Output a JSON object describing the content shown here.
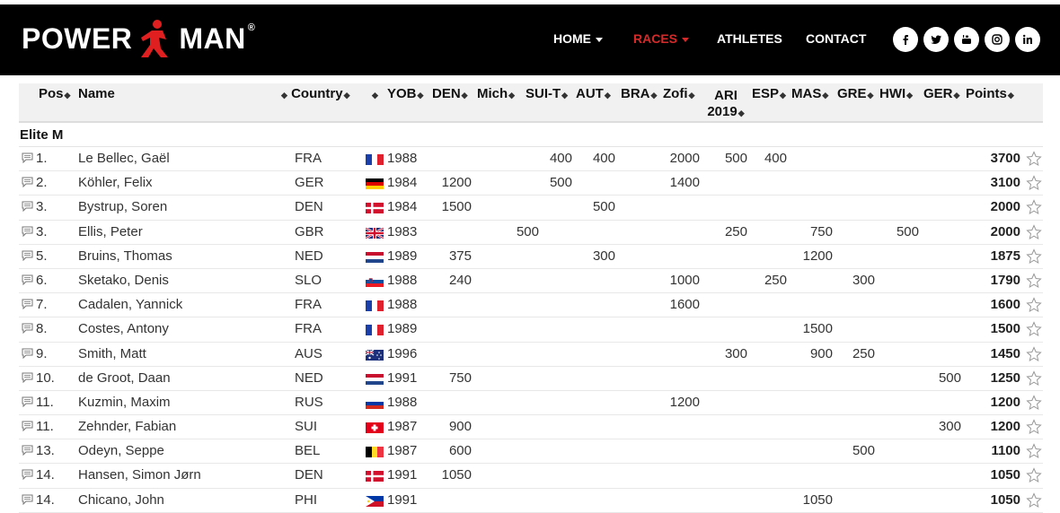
{
  "brand": {
    "name_left": "POWER",
    "name_right": "MAN",
    "registered": "®"
  },
  "nav": [
    {
      "label": "HOME",
      "caret": true,
      "active": false
    },
    {
      "label": "RACES",
      "caret": true,
      "active": true
    },
    {
      "label": "ATHLETES",
      "caret": false,
      "active": false
    },
    {
      "label": "CONTACT",
      "caret": false,
      "active": false
    }
  ],
  "social": [
    "facebook-icon",
    "twitter-icon",
    "youtube-icon",
    "instagram-icon",
    "linkedin-icon"
  ],
  "colors": {
    "accent": "#d62a2a",
    "header_bg": "#000000",
    "head_bg": "#f1f1f1"
  },
  "table": {
    "headers": [
      "Pos",
      "Name",
      "Country",
      "",
      "YOB",
      "DEN",
      "Mich",
      "SUI-T",
      "AUT",
      "BRA",
      "Zofi",
      "ARI 2019",
      "ESP",
      "MAS",
      "GRE",
      "HWI",
      "GER",
      "Points"
    ],
    "group": "Elite M",
    "rows": [
      {
        "pos": "1.",
        "name": "Le Bellec, Gaël",
        "country": "FRA",
        "flag": "fra",
        "yob": "1988",
        "den": "",
        "mich": "",
        "suit": "400",
        "aut": "400",
        "bra": "",
        "zofi": "2000",
        "ari": "500",
        "esp": "400",
        "mas": "",
        "gre": "",
        "hwi": "",
        "ger": "",
        "points": "3700"
      },
      {
        "pos": "2.",
        "name": "Köhler, Felix",
        "country": "GER",
        "flag": "ger",
        "yob": "1984",
        "den": "1200",
        "mich": "",
        "suit": "500",
        "aut": "",
        "bra": "",
        "zofi": "1400",
        "ari": "",
        "esp": "",
        "mas": "",
        "gre": "",
        "hwi": "",
        "ger": "",
        "points": "3100"
      },
      {
        "pos": "3.",
        "name": "Bystrup, Soren",
        "country": "DEN",
        "flag": "den",
        "yob": "1984",
        "den": "1500",
        "mich": "",
        "suit": "",
        "aut": "500",
        "bra": "",
        "zofi": "",
        "ari": "",
        "esp": "",
        "mas": "",
        "gre": "",
        "hwi": "",
        "ger": "",
        "points": "2000"
      },
      {
        "pos": "3.",
        "name": "Ellis, Peter",
        "country": "GBR",
        "flag": "gbr",
        "yob": "1983",
        "den": "",
        "mich": "500",
        "suit": "",
        "aut": "",
        "bra": "",
        "zofi": "",
        "ari": "250",
        "esp": "",
        "mas": "750",
        "gre": "",
        "hwi": "500",
        "ger": "",
        "points": "2000"
      },
      {
        "pos": "5.",
        "name": "Bruins, Thomas",
        "country": "NED",
        "flag": "ned",
        "yob": "1989",
        "den": "375",
        "mich": "",
        "suit": "",
        "aut": "300",
        "bra": "",
        "zofi": "",
        "ari": "",
        "esp": "",
        "mas": "1200",
        "gre": "",
        "hwi": "",
        "ger": "",
        "points": "1875"
      },
      {
        "pos": "6.",
        "name": "Sketako, Denis",
        "country": "SLO",
        "flag": "slo",
        "yob": "1988",
        "den": "240",
        "mich": "",
        "suit": "",
        "aut": "",
        "bra": "",
        "zofi": "1000",
        "ari": "",
        "esp": "250",
        "mas": "",
        "gre": "300",
        "hwi": "",
        "ger": "",
        "points": "1790"
      },
      {
        "pos": "7.",
        "name": "Cadalen, Yannick",
        "country": "FRA",
        "flag": "fra",
        "yob": "1988",
        "den": "",
        "mich": "",
        "suit": "",
        "aut": "",
        "bra": "",
        "zofi": "1600",
        "ari": "",
        "esp": "",
        "mas": "",
        "gre": "",
        "hwi": "",
        "ger": "",
        "points": "1600"
      },
      {
        "pos": "8.",
        "name": "Costes, Antony",
        "country": "FRA",
        "flag": "fra",
        "yob": "1989",
        "den": "",
        "mich": "",
        "suit": "",
        "aut": "",
        "bra": "",
        "zofi": "",
        "ari": "",
        "esp": "",
        "mas": "1500",
        "gre": "",
        "hwi": "",
        "ger": "",
        "points": "1500"
      },
      {
        "pos": "9.",
        "name": "Smith, Matt",
        "country": "AUS",
        "flag": "aus",
        "yob": "1996",
        "den": "",
        "mich": "",
        "suit": "",
        "aut": "",
        "bra": "",
        "zofi": "",
        "ari": "300",
        "esp": "",
        "mas": "900",
        "gre": "250",
        "hwi": "",
        "ger": "",
        "points": "1450"
      },
      {
        "pos": "10.",
        "name": "de Groot, Daan",
        "country": "NED",
        "flag": "ned",
        "yob": "1991",
        "den": "750",
        "mich": "",
        "suit": "",
        "aut": "",
        "bra": "",
        "zofi": "",
        "ari": "",
        "esp": "",
        "mas": "",
        "gre": "",
        "hwi": "",
        "ger": "500",
        "points": "1250"
      },
      {
        "pos": "11.",
        "name": "Kuzmin, Maxim",
        "country": "RUS",
        "flag": "rus",
        "yob": "1988",
        "den": "",
        "mich": "",
        "suit": "",
        "aut": "",
        "bra": "",
        "zofi": "1200",
        "ari": "",
        "esp": "",
        "mas": "",
        "gre": "",
        "hwi": "",
        "ger": "",
        "points": "1200"
      },
      {
        "pos": "11.",
        "name": "Zehnder, Fabian",
        "country": "SUI",
        "flag": "sui",
        "yob": "1987",
        "den": "900",
        "mich": "",
        "suit": "",
        "aut": "",
        "bra": "",
        "zofi": "",
        "ari": "",
        "esp": "",
        "mas": "",
        "gre": "",
        "hwi": "",
        "ger": "300",
        "points": "1200"
      },
      {
        "pos": "13.",
        "name": "Odeyn, Seppe",
        "country": "BEL",
        "flag": "bel",
        "yob": "1987",
        "den": "600",
        "mich": "",
        "suit": "",
        "aut": "",
        "bra": "",
        "zofi": "",
        "ari": "",
        "esp": "",
        "mas": "",
        "gre": "500",
        "hwi": "",
        "ger": "",
        "points": "1100"
      },
      {
        "pos": "14.",
        "name": "Hansen, Simon Jørn",
        "country": "DEN",
        "flag": "den",
        "yob": "1991",
        "den": "1050",
        "mich": "",
        "suit": "",
        "aut": "",
        "bra": "",
        "zofi": "",
        "ari": "",
        "esp": "",
        "mas": "",
        "gre": "",
        "hwi": "",
        "ger": "",
        "points": "1050"
      },
      {
        "pos": "14.",
        "name": "Chicano, John",
        "country": "PHI",
        "flag": "phi",
        "yob": "1991",
        "den": "",
        "mich": "",
        "suit": "",
        "aut": "",
        "bra": "",
        "zofi": "",
        "ari": "",
        "esp": "",
        "mas": "1050",
        "gre": "",
        "hwi": "",
        "ger": "",
        "points": "1050"
      }
    ]
  }
}
